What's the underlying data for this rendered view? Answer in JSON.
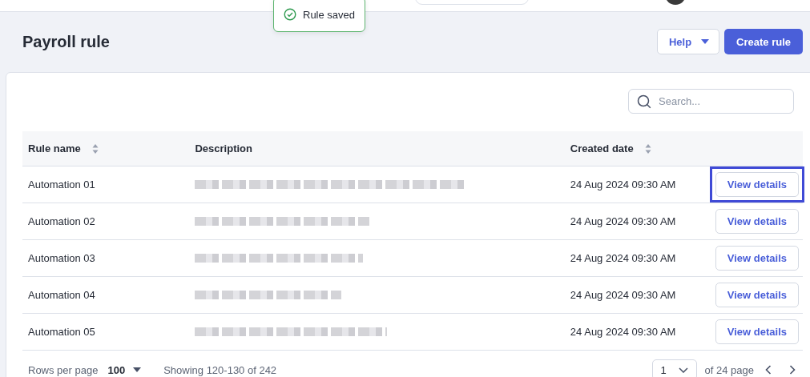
{
  "toast": {
    "message": "Rule saved"
  },
  "page": {
    "title": "Payroll rule"
  },
  "actions": {
    "help": "Help",
    "create": "Create rule"
  },
  "search": {
    "placeholder": "Search..."
  },
  "table": {
    "columns": [
      {
        "label": "Rule name",
        "sortable": true
      },
      {
        "label": "Description",
        "sortable": false
      },
      {
        "label": "Created date",
        "sortable": true
      }
    ],
    "rows": [
      {
        "name": "Automation 01",
        "created": "24 Aug 2024 09:30 AM",
        "action": "View details",
        "focused": true
      },
      {
        "name": "Automation 02",
        "created": "24 Aug 2024 09:30 AM",
        "action": "View details",
        "focused": false
      },
      {
        "name": "Automation 03",
        "created": "24 Aug 2024 09:30 AM",
        "action": "View details",
        "focused": false
      },
      {
        "name": "Automation 04",
        "created": "24 Aug 2024 09:30 AM",
        "action": "View details",
        "focused": false
      },
      {
        "name": "Automation 05",
        "created": "24 Aug 2024 09:30 AM",
        "action": "View details",
        "focused": false
      }
    ]
  },
  "footer": {
    "rows_label": "Rows per page",
    "rows_value": "100",
    "showing": "Showing 120-130 of 242",
    "page_value": "1",
    "page_total": "of 24 page"
  }
}
